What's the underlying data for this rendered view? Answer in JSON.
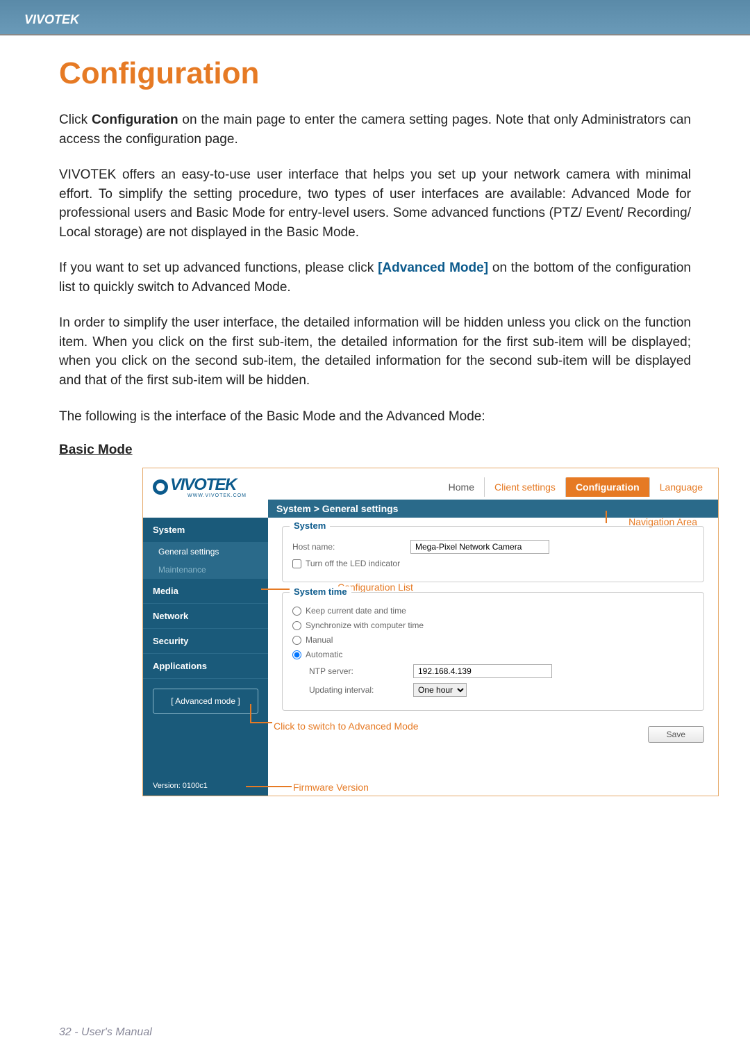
{
  "page_header": "VIVOTEK",
  "page_title": "Configuration",
  "paragraphs": {
    "p1_pre": "Click ",
    "p1_bold": "Configuration",
    "p1_post": " on the main page to enter the camera setting pages. Note that only Administrators can access the configuration page.",
    "p2": "VIVOTEK offers an easy-to-use user interface that helps you set up your network camera with minimal effort. To simplify the setting procedure, two types of user interfaces are available: Advanced Mode for professional users and Basic Mode for entry-level users. Some advanced functions (PTZ/ Event/ Recording/ Local storage) are not displayed in the Basic Mode.",
    "p3_pre": "If you want to set up advanced functions, please click ",
    "p3_link": "[Advanced Mode]",
    "p3_post": " on the bottom of the configuration list to quickly switch to Advanced Mode.",
    "p4": "In order to simplify the user interface, the detailed information will be hidden unless you click on the function item. When you click on the first sub-item, the detailed information for the first sub-item will be displayed; when you click on the second sub-item, the detailed information for the second sub-item will be displayed and that of the first sub-item will be hidden.",
    "p5": "The following is the interface of the Basic Mode and the Advanced Mode:"
  },
  "section_label": "Basic Mode",
  "screenshot": {
    "logo_text": "VIVOTEK",
    "logo_sub": "WWW.VIVOTEK.COM",
    "nav": {
      "home": "Home",
      "client": "Client settings",
      "config": "Configuration",
      "language": "Language"
    },
    "breadcrumb": "System  >  General settings",
    "sidebar": {
      "system": "System",
      "general": "General settings",
      "maintenance": "Maintenance",
      "media": "Media",
      "network": "Network",
      "security": "Security",
      "applications": "Applications",
      "advanced": "[ Advanced mode ]",
      "version": "Version: 0100c1"
    },
    "panel": {
      "system_legend": "System",
      "hostname_label": "Host name:",
      "hostname_value": "Mega-Pixel Network Camera",
      "led_label": "Turn off the LED indicator",
      "time_legend": "System time",
      "keep_label": "Keep current date and time",
      "sync_label": "Synchronize with computer time",
      "manual_label": "Manual",
      "auto_label": "Automatic",
      "ntp_label": "NTP server:",
      "ntp_value": "192.168.4.139",
      "interval_label": "Updating interval:",
      "interval_value": "One hour",
      "save": "Save"
    },
    "callouts": {
      "nav_area": "Navigation Area",
      "config_list": "Configuration List",
      "switch": "Click to switch to Advanced Mode",
      "fw": "Firmware Version"
    }
  },
  "footer": "32 - User's Manual"
}
